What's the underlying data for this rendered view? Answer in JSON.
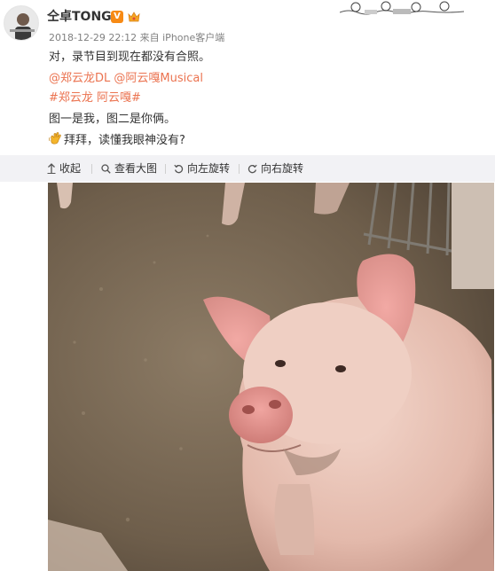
{
  "post": {
    "username": "仝卓TONG",
    "verified_badge": "V",
    "timestamp": "2018-12-29 22:12",
    "source_prefix": "来自",
    "device": "iPhone客户端",
    "line1": "对，录节目到现在都没有合照。",
    "mention1": "@郑云龙DL",
    "mention2": "@阿云嘎Musical",
    "tag1": "#郑云龙 阿云嘎#",
    "line4": "图一是我，图二是你俩。",
    "line5_text": "拜拜，读懂我眼神没有?"
  },
  "toolbar": {
    "collapse_label": "收起",
    "view_large_label": "查看大图",
    "rotate_left_label": "向左旋转",
    "rotate_right_label": "向右旋转"
  },
  "icons": {
    "collapse": "arrow-up-icon",
    "view_large": "magnifier-icon",
    "rotate_left": "rotate-left-icon",
    "rotate_right": "rotate-right-icon",
    "emoji": "waving-hand-emoji"
  },
  "colors": {
    "link": "#eb7350",
    "toolbar_bg": "#f2f2f5",
    "verified": "#f78a15"
  }
}
